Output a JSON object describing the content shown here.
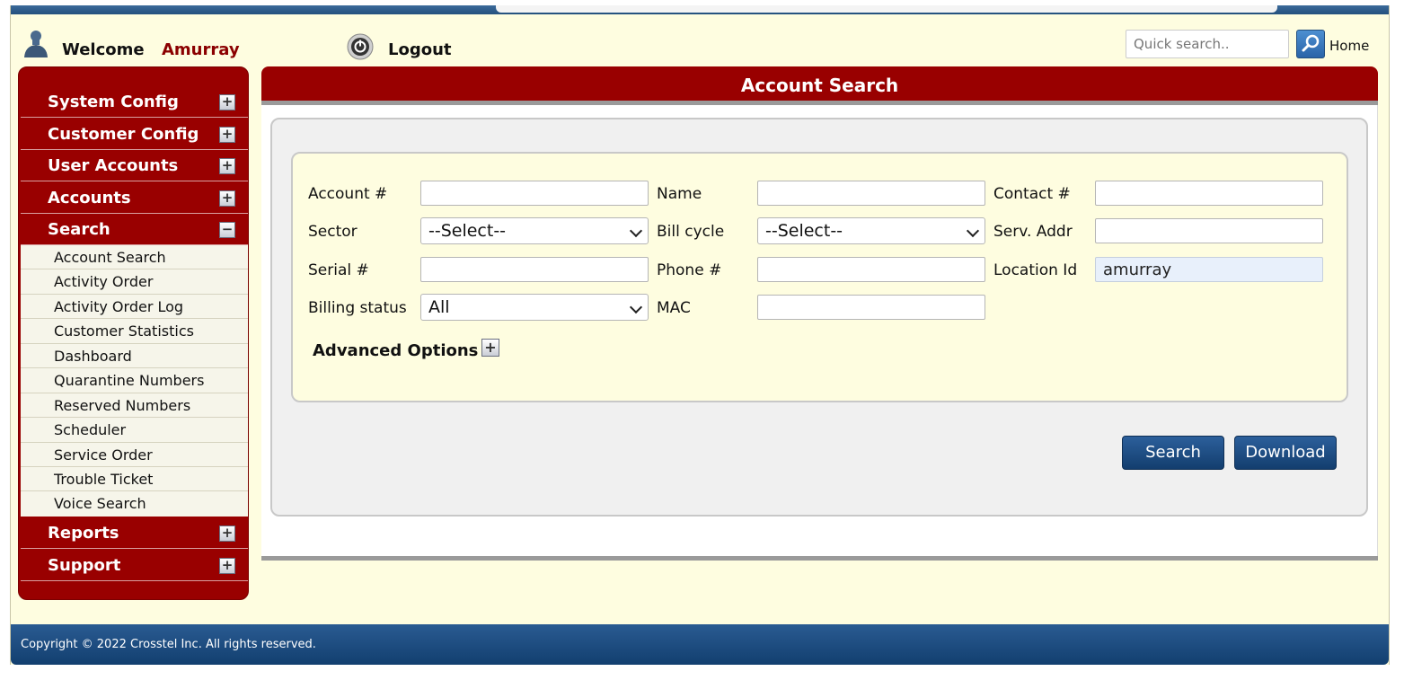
{
  "header": {
    "welcome_label": "Welcome",
    "username": "Amurray",
    "logout_label": "Logout",
    "quick_search_placeholder": "Quick search..",
    "home_label": "Home"
  },
  "sidebar": {
    "sections": [
      {
        "label": "System Config",
        "toggle": "+"
      },
      {
        "label": "Customer Config",
        "toggle": "+"
      },
      {
        "label": "User Accounts",
        "toggle": "+"
      },
      {
        "label": "Accounts",
        "toggle": "+"
      },
      {
        "label": "Search",
        "toggle": "−"
      },
      {
        "label": "Reports",
        "toggle": "+"
      },
      {
        "label": "Support",
        "toggle": "+"
      }
    ],
    "search_items": [
      "Account Search",
      "Activity Order",
      "Activity Order Log",
      "Customer Statistics",
      "Dashboard",
      "Quarantine Numbers",
      "Reserved Numbers",
      "Scheduler",
      "Service Order",
      "Trouble Ticket",
      "Voice Search"
    ]
  },
  "main": {
    "title": "Account Search",
    "form": {
      "account_label": "Account #",
      "name_label": "Name",
      "contact_label": "Contact #",
      "sector_label": "Sector",
      "sector_value": "--Select--",
      "bill_cycle_label": "Bill cycle",
      "bill_cycle_value": "--Select--",
      "serv_addr_label": "Serv. Addr",
      "serial_label": "Serial #",
      "phone_label": "Phone #",
      "location_label": "Location Id",
      "location_value": "amurray",
      "billing_status_label": "Billing status",
      "billing_status_value": "All",
      "mac_label": "MAC",
      "advanced_label": "Advanced Options",
      "advanced_toggle": "+"
    },
    "search_button": "Search",
    "download_button": "Download"
  },
  "footer": {
    "copyright": "Copyright © 2022 Crosstel Inc. All rights reserved."
  },
  "colors": {
    "brand_red": "#990000",
    "nav_blue": "#1f4f84",
    "panel_cream": "#fefde0"
  }
}
